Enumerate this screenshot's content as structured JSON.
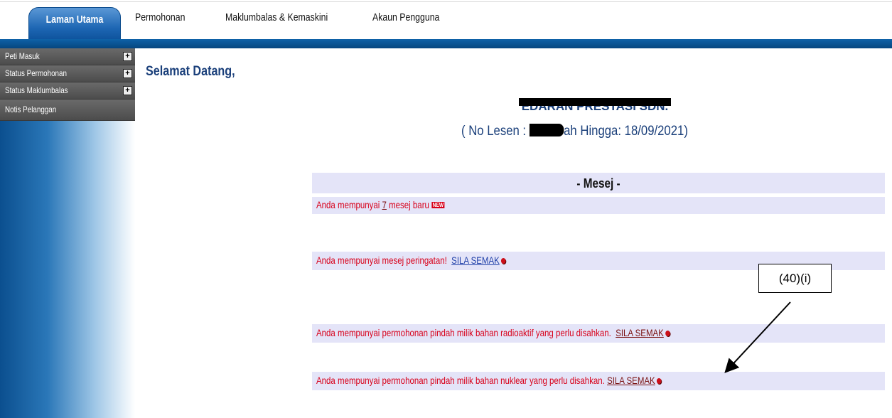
{
  "nav": {
    "tabs": [
      "Laman Utama",
      "Permohonan",
      "Maklumbalas & Kemaskini",
      "Akaun Pengguna"
    ],
    "active_tab": "Laman Utama"
  },
  "sidebar": {
    "items": [
      {
        "label": "Peti Masuk",
        "icon": "plus-expand-icon"
      },
      {
        "label": "Status Permohonan",
        "icon": "plus-expand-icon"
      },
      {
        "label": "Status Maklumbalas",
        "icon": "plus-expand-icon"
      },
      {
        "label": "Notis Pelanggan"
      }
    ]
  },
  "main": {
    "welcome": "Selamat Datang,",
    "company_name": "EDARAN PRESTASI SDN. BHD.",
    "license_prefix": "( No Lesen : ",
    "license_suffix": "ah Hingga: 18/09/2021)"
  },
  "messages": {
    "header": "- Mesej -",
    "new_prefix": "Anda mempunyai ",
    "new_count": "7",
    "new_suffix": " mesej baru",
    "new_badge": "NEW",
    "warning_text": "Anda mempunyai mesej peringatan!",
    "radioactive_text": "Anda mempunyai permohonan pindah milik bahan radioaktif yang perlu disahkan.",
    "nuclear_text": "Anda mempunyai permohonan pindah milik bahan nuklear yang perlu disahkan.",
    "check_link": "SILA SEMAK"
  },
  "annotation": {
    "label": "(40)(i)"
  },
  "colors": {
    "nav_bar": "#06467f",
    "message_text": "#d8001a",
    "heading_text": "#1a3f7a",
    "message_bg": "#e4e4f8"
  }
}
